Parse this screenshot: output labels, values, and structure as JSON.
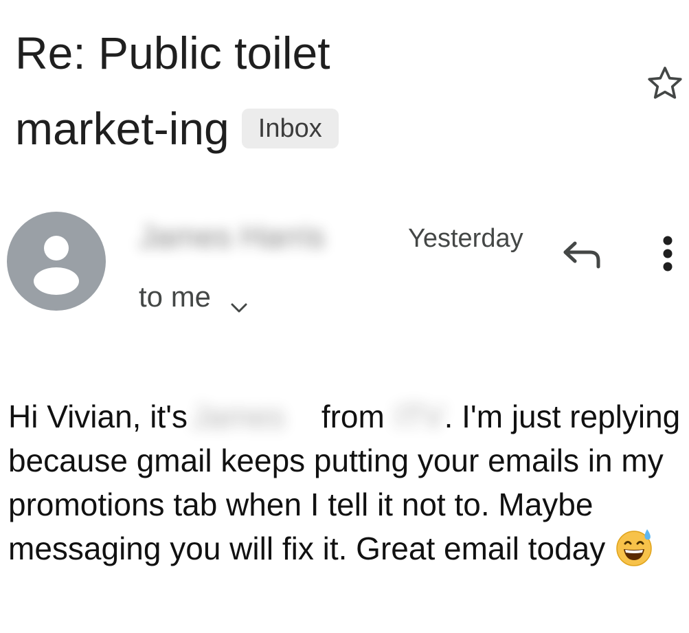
{
  "email": {
    "subject_line1": "Re: Public toilet",
    "subject_line2": "market-ing",
    "label": "Inbox",
    "sender_name": "James Harris",
    "timestamp": "Yesterday",
    "recipient": "to me",
    "body": {
      "greeting": "Hi Vivian, it's",
      "redacted_name": "James",
      "from_word": "from",
      "redacted_company": "ITV",
      "rest": ". I'm just replying because gmail keeps putting your emails in my promotions tab when I tell it not to. Maybe messaging you will fix it. Great email today"
    }
  },
  "icons": {
    "star": "star-outline-icon",
    "avatar": "default-avatar-icon",
    "reply": "reply-icon",
    "more": "more-vertical-icon",
    "chevron": "chevron-down-icon",
    "emoji": "grinning-face-with-sweat-emoji"
  },
  "colors": {
    "avatar_bg": "#9aa0a6",
    "chip_bg": "#ececec",
    "text_primary": "#1f1f1f",
    "text_secondary": "#444746"
  }
}
